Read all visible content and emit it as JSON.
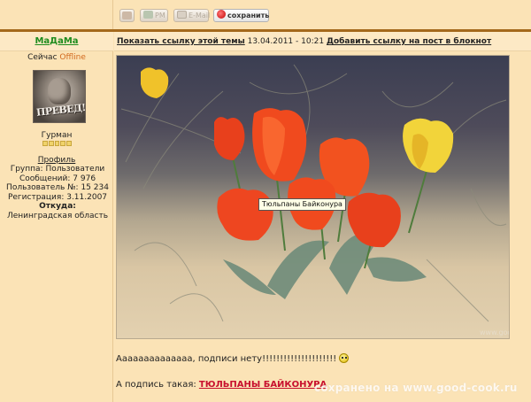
{
  "toolbar": {
    "pm_label": "PM",
    "email_label": "E-Mail",
    "save_label": "сохранить"
  },
  "sidebar": {
    "username": "МаДаМа",
    "status_prefix": "Сейчас",
    "status_value": "Offline",
    "avatar_text": "ПРЕВЕД!",
    "rank": "Гурман",
    "rank_pips": 5,
    "profile_link": "Профиль",
    "group": "Группа: Пользователи",
    "messages": "Сообщений: 7 976",
    "user_number": "Пользователь №: 15 234",
    "registration": "Регистрация: 3.11.2007",
    "location_label": "Откуда:",
    "location_value": "Ленинградская область"
  },
  "post": {
    "show_link": "Показать ссылку этой темы",
    "datetime": "13.04.2011 - 10:21",
    "add_link": "Добавить ссылку на пост в блокнот",
    "image_tooltip": "Тюльпаны Байконура",
    "image_watermark": "www.good-cook.ru",
    "message": "Аааааааааааааа, подписи нету!!!!!!!!!!!!!!!!!!!!!",
    "signature_prefix": "А подпись такая:",
    "signature_link": "ТЮЛЬПАНЫ БАЙКОНУРА",
    "page_watermark": "сохранено на www.good-cook.ru"
  },
  "colors": {
    "background": "#fbe3b6",
    "header_bar": "#a4691c",
    "username": "#1e8c1e",
    "offline": "#d2691e",
    "signature_link": "#c8102e"
  },
  "icons": [
    "user-icon",
    "pm-icon",
    "email-icon",
    "save-icon",
    "smiley-icon"
  ]
}
